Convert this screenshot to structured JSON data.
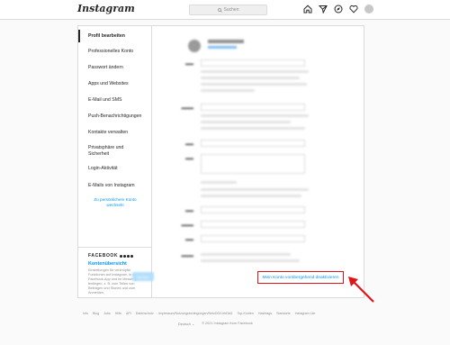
{
  "nav": {
    "logo": "Instagram",
    "search_placeholder": "Suchen"
  },
  "sidebar": {
    "items": [
      {
        "label": "Profil bearbeiten"
      },
      {
        "label": "Professionelles Konto"
      },
      {
        "label": "Passwort ändern"
      },
      {
        "label": "Apps und Websites"
      },
      {
        "label": "E-Mail und SMS"
      },
      {
        "label": "Push-Benachrichtigungen"
      },
      {
        "label": "Kontakte verwalten"
      },
      {
        "label": "Privatsphäre und"
      },
      {
        "label": "Login-Aktivität"
      },
      {
        "label": "E-Mails von Instagram"
      }
    ],
    "privacy_line2": "Sicherheit",
    "switch_link_line1": "Zu persönlichem Konto",
    "switch_link_line2": "wechseln"
  },
  "facebook": {
    "title": "FACEBOOK",
    "link": "Kontenübersicht",
    "description": "Einstellungen für verknüpfte Funktionen auf Instagram, in der Facebook-App und im Messenger festlegen, z. B. zum Teilen von Beiträgen und Stories und zum Anmelden."
  },
  "form": {
    "submit_label": "Senden",
    "deactivate_label": "Mein Konto vorübergehend deaktivieren"
  },
  "footer": {
    "links": [
      "Info",
      "Blog",
      "Jobs",
      "Hilfe",
      "API",
      "Datenschutz",
      "Impressum/Nutzungsbedingungen/NetzDG/UrhDaG",
      "Top-Konten",
      "Hashtags",
      "Standorte",
      "Instagram Lite"
    ],
    "language": "Deutsch",
    "copyright": "© 2021 Instagram from Facebook"
  },
  "colors": {
    "accent": "#0095f6",
    "highlight_box": "#e0141a"
  }
}
